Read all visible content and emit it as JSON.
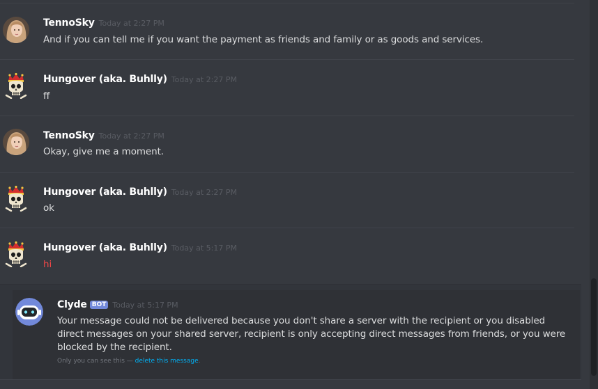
{
  "messages": [
    {
      "author": "TennoSky",
      "timestamp": "Today at 2:27 PM",
      "text": "And if you can tell me if you want the payment as friends and family or as goods and services.",
      "avatar": "avatar-photo"
    },
    {
      "author": "Hungover (aka. Buhlly)",
      "timestamp": "Today at 2:27 PM",
      "text": "ff",
      "avatar": "crowned-skull-icon"
    },
    {
      "author": "TennoSky",
      "timestamp": "Today at 2:27 PM",
      "text": "Okay, give me a moment.",
      "avatar": "avatar-photo"
    },
    {
      "author": "Hungover (aka. Buhlly)",
      "timestamp": "Today at 2:27 PM",
      "text": "ok",
      "avatar": "crowned-skull-icon"
    },
    {
      "author": "Hungover (aka. Buhlly)",
      "timestamp": "Today at 5:17 PM",
      "text": "hi",
      "avatar": "crowned-skull-icon",
      "text_color": "#f04747"
    }
  ],
  "clyde": {
    "author": "Clyde",
    "badge": "BOT",
    "timestamp": "Today at 5:17 PM",
    "body": "Your message could not be delivered because you don't share a server with the recipient or you disabled direct messages on your shared server, recipient is only accepting direct messages from friends, or you were blocked by the recipient.",
    "note_prefix": "Only you can see this — ",
    "note_link": "delete this message",
    "note_suffix": ".",
    "avatar": "clyde-robot-icon"
  },
  "colors": {
    "background": "#36393f",
    "ephemeral_bg": "#2f3136",
    "link": "#00b0f4",
    "bot_badge": "#7289da",
    "error_text": "#f04747"
  }
}
